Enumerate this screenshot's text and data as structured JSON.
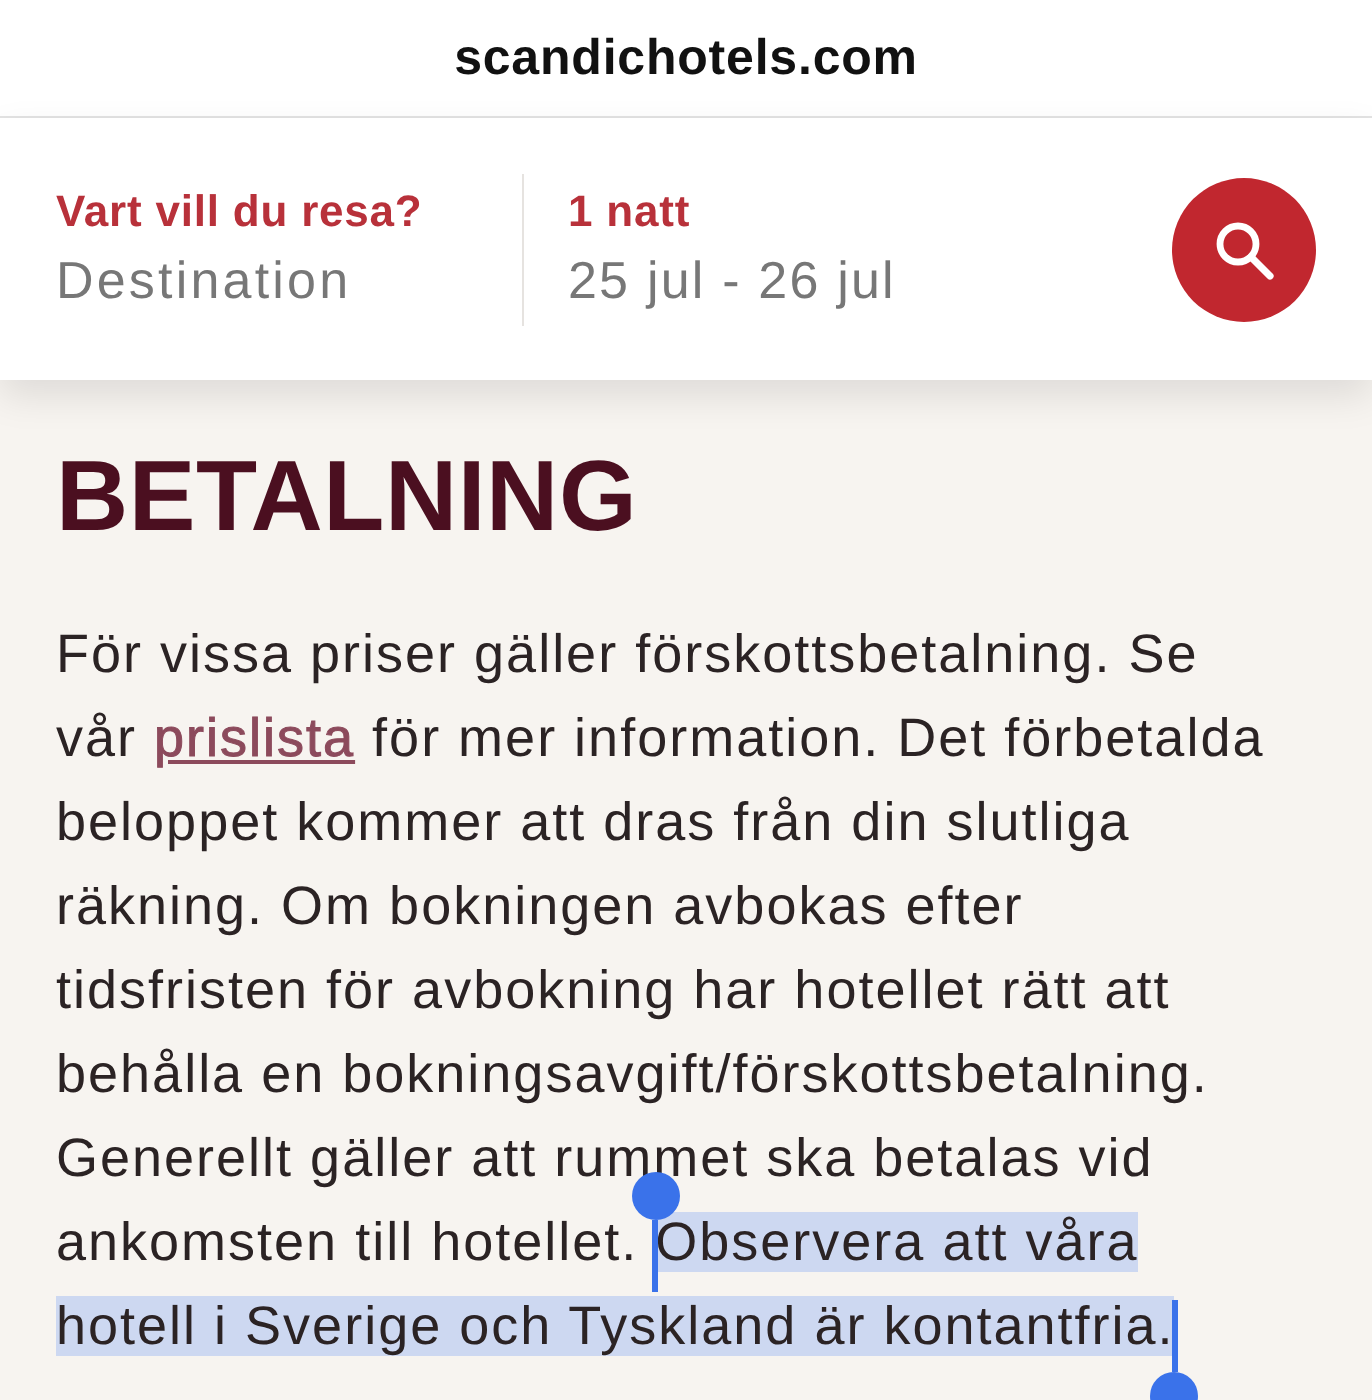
{
  "browser_bar": {
    "url": "scandichotels.com"
  },
  "booking_bar": {
    "destination": {
      "label": "Vart vill du resa?",
      "placeholder": "Destination"
    },
    "dates": {
      "label": "1 natt",
      "value": "25 jul - 26 jul"
    }
  },
  "article": {
    "heading": "BETALNING",
    "parts": [
      {
        "kind": "text",
        "text": "För vissa priser gäller förskottsbetalning. Se vår ",
        "selected": false
      },
      {
        "kind": "link",
        "text": "prislista",
        "selected": false
      },
      {
        "kind": "text",
        "text": " för mer information. Det förbetalda beloppet kommer att dras från din slutliga räkning. Om bokningen avbokas efter tidsfristen för avbokning har hotellet rätt att behålla en bokningsavgift/förskottsbetalning. Generellt gäller att rummet ska betalas vid ankomsten till hotellet. ",
        "selected": false
      },
      {
        "kind": "text",
        "text": "Observera att våra ",
        "selected": true
      },
      {
        "kind": "text",
        "text": "hotell i Sverige och Tyskland är kontantfria.",
        "selected": true
      }
    ]
  }
}
